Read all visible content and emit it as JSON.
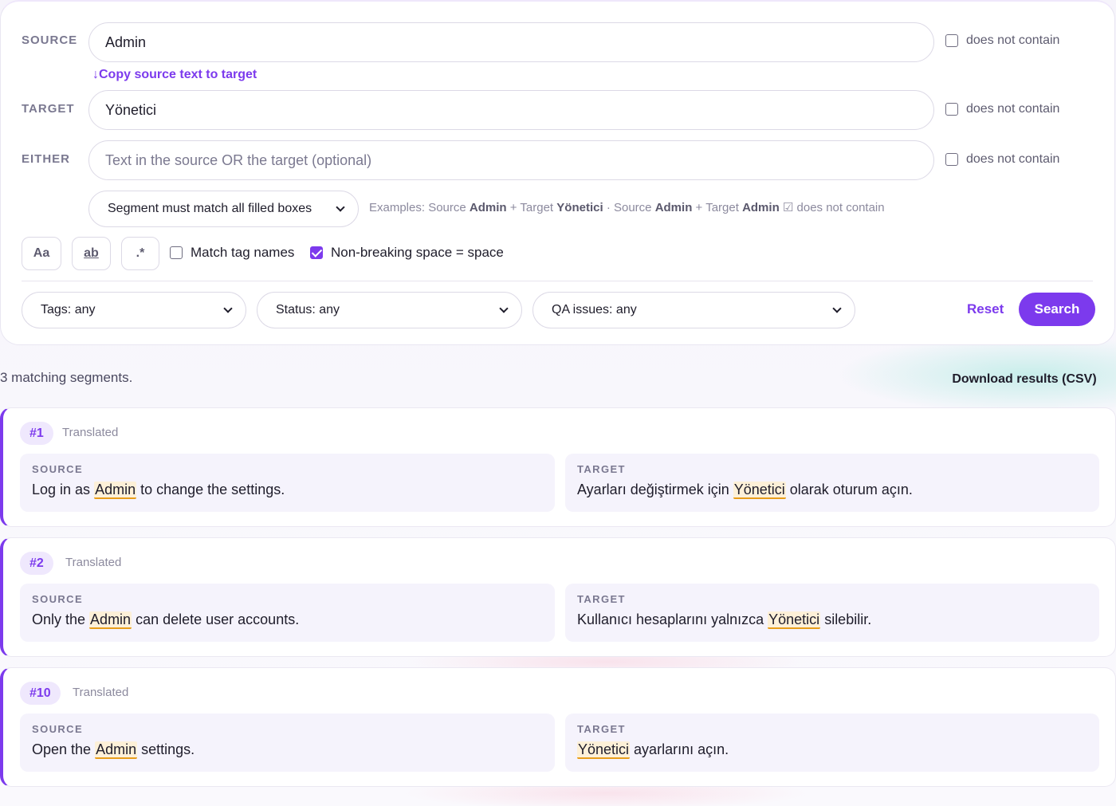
{
  "filters": {
    "source": {
      "label": "SOURCE",
      "value": "Admin",
      "dnc_label": "does not contain",
      "dnc_checked": false
    },
    "copy_link": "↓Copy source text to target",
    "target": {
      "label": "TARGET",
      "value": "Yönetici",
      "dnc_label": "does not contain",
      "dnc_checked": false
    },
    "either": {
      "label": "EITHER",
      "placeholder": "Text in the source OR the target (optional)",
      "dnc_label": "does not contain",
      "dnc_checked": false
    },
    "match_mode": "Segment must match all filled boxes",
    "examples": {
      "prefix": "Examples: Source",
      "ex1_src": "Admin",
      "plus1": "+ Target",
      "ex1_tgt": "Yönetici",
      "sep": "· Source",
      "ex2_src": "Admin",
      "plus2": "+ Target",
      "ex2_tgt": "Admin",
      "suffix": "☑ does not contain"
    },
    "options": {
      "case_btn": "Aa",
      "whole_word_btn": "ab",
      "regex_btn": ".*",
      "match_tag_names": "Match tag names",
      "match_tag_names_checked": false,
      "nbsp": "Non-breaking space = space",
      "nbsp_checked": true
    },
    "tags_select": "Tags: any",
    "status_select": "Status: any",
    "qa_select": "QA issues: any",
    "reset": "Reset",
    "search": "Search"
  },
  "results": {
    "count_text": "3 matching segments.",
    "download": "Download results (CSV)",
    "items": [
      {
        "id": "#1",
        "status": "Translated",
        "source_head": "SOURCE",
        "source_pre": "Log in as ",
        "source_hit": "Admin",
        "source_post": " to change the settings.",
        "target_head": "TARGET",
        "target_pre": "Ayarları değiştirmek için ",
        "target_hit": "Yönetici",
        "target_post": " olarak oturum açın."
      },
      {
        "id": "#2",
        "status": "Translated",
        "source_head": "SOURCE",
        "source_pre": "Only the ",
        "source_hit": "Admin",
        "source_post": " can delete user accounts.",
        "target_head": "TARGET",
        "target_pre": "Kullanıcı hesaplarını yalnızca ",
        "target_hit": "Yönetici",
        "target_post": " silebilir."
      },
      {
        "id": "#10",
        "status": "Translated",
        "source_head": "SOURCE",
        "source_pre": "Open the ",
        "source_hit": "Admin",
        "source_post": " settings.",
        "target_head": "TARGET",
        "target_pre": "",
        "target_hit": "Yönetici",
        "target_post": " ayarlarını açın."
      }
    ]
  },
  "colors": {
    "accent": "#7c3aed",
    "highlight_bg": "#fdf0d8",
    "highlight_line": "#e89d1a"
  }
}
